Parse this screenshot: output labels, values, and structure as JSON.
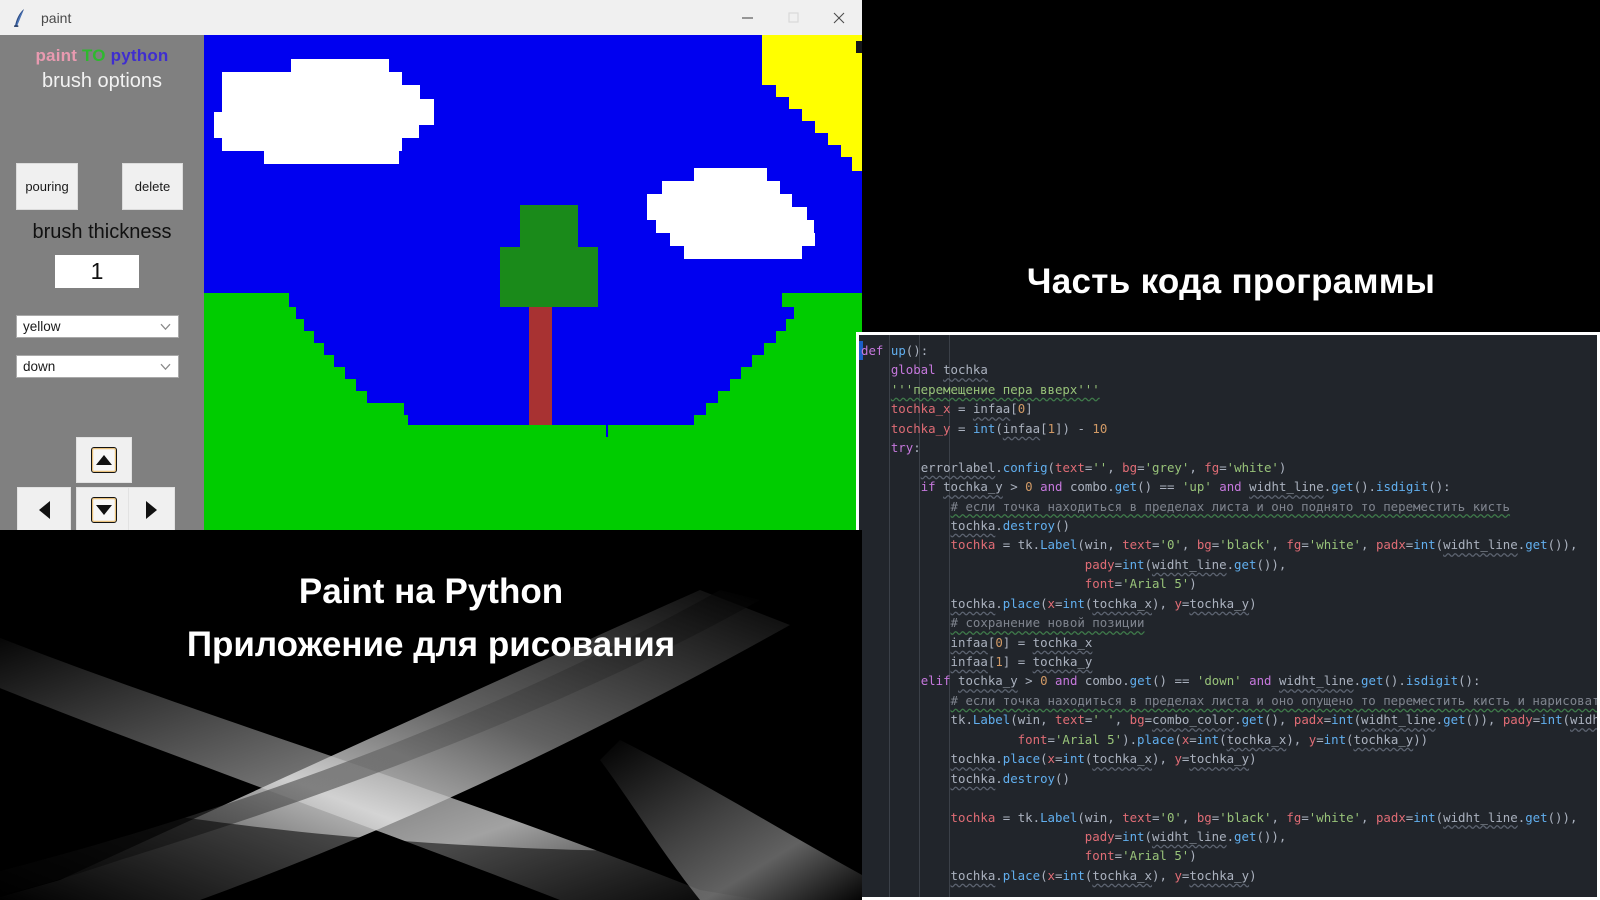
{
  "window": {
    "title": "paint",
    "icon": "python-feather-icon",
    "controls": {
      "minimize": "–",
      "maximize": "☐",
      "close": "✕"
    }
  },
  "tool_panel": {
    "brand": {
      "word1": "paint",
      "word2": "TO",
      "word3": "python"
    },
    "brand_colors": {
      "word1": "#e89ab0",
      "word2": "#2eb82e",
      "word3": "#3f2ecf"
    },
    "brush_options_label": "brush options",
    "buttons": {
      "pouring": "pouring",
      "delete": "delete"
    },
    "brush_thickness_label": "brush thickness",
    "thickness_value": "1",
    "color_select": {
      "value": "yellow"
    },
    "direction_select": {
      "value": "down"
    },
    "dpad": {
      "up": "▲",
      "down": "▼",
      "left": "◀",
      "right": "▶"
    },
    "panel_bg": "#808080"
  },
  "canvas": {
    "sky_color": "#0000f0",
    "grass_color": "#00cc00",
    "cloud_color": "#ffffff",
    "sun_color": "#ffff00",
    "tree_crown_color": "#1a8a1a",
    "tree_trunk_color": "#a83232"
  },
  "right_slide": {
    "heading": "Часть кода программы",
    "code_lines": [
      "def up():",
      "    global tochka",
      "    '''перемещение пера вверх'''",
      "    tochka_x = infaa[0]",
      "    tochka_y = int(infaa[1]) - 10",
      "    try:",
      "        errorlabel.config(text='', bg='grey', fg='white')",
      "        if tochka_y > 0 and combo.get() == 'up' and widht_line.get().isdigit():",
      "            # если точка находиться в пределах листа и оно поднято то переместить кисть",
      "            tochka.destroy()",
      "            tochka = tk.Label(win, text='0', bg='black', fg='white', padx=int(widht_line.get()),",
      "                              pady=int(widht_line.get()),",
      "                              font='Arial 5')",
      "            tochka.place(x=int(tochka_x), y=tochka_y)",
      "            # сохранение новой позиции",
      "            infaa[0] = tochka_x",
      "            infaa[1] = tochka_y",
      "        elif tochka_y > 0 and combo.get() == 'down' and widht_line.get().isdigit():",
      "            # если точка находиться в пределах листа и оно опущено то переместить кисть и нарисовать",
      "            tk.Label(win, text=' ', bg=combo_color.get(), padx=int(widht_line.get()), pady=int(widht_line.get()),",
      "                     font='Arial 5').place(x=int(tochka_x), y=int(tochka_y))",
      "            tochka.place(x=int(tochka_x), y=tochka_y)",
      "            tochka.destroy()",
      "",
      "            tochka = tk.Label(win, text='0', bg='black', fg='white', padx=int(widht_line.get()),",
      "                              pady=int(widht_line.get()),",
      "                              font='Arial 5')",
      "            tochka.place(x=int(tochka_x), y=tochka_y)"
    ],
    "theme": {
      "background": "#21252b",
      "keyword": "#c678dd",
      "function": "#61afef",
      "string": "#98c379",
      "number": "#d19a66",
      "parameter": "#e06c75",
      "comment": "#7f848e",
      "plain": "#abb2bf"
    }
  },
  "bottom_slide": {
    "title": "Paint на Python",
    "subtitle": "Приложение для рисования"
  }
}
